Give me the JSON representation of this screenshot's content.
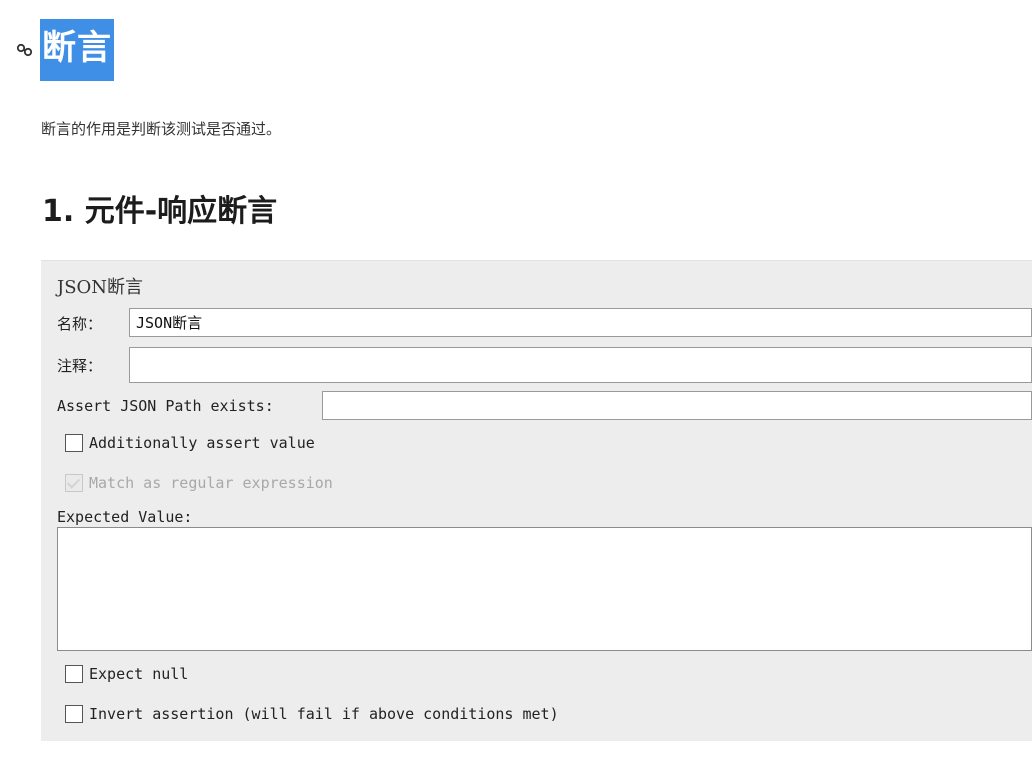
{
  "heading": {
    "icon": "link-icon",
    "title": "断言",
    "accent": "#3f8fe6"
  },
  "intro_text": "断言的作用是判断该测试是否通过。",
  "section_title": "1. 元件-响应断言",
  "panel": {
    "title": "JSON断言",
    "name_label": "名称：",
    "name_value": "JSON断言",
    "comment_label": "注释：",
    "comment_value": "",
    "path_label": "Assert JSON Path exists:",
    "path_value": "",
    "additionally_assert_label": "Additionally assert value",
    "additionally_assert_checked": false,
    "regex_label": "Match as regular expression",
    "regex_checked": true,
    "regex_enabled": false,
    "expected_value_label": "Expected Value:",
    "expected_value": "",
    "expect_null_label": "Expect null",
    "expect_null_checked": false,
    "invert_label": "Invert assertion (will fail if above conditions met)",
    "invert_checked": false
  }
}
